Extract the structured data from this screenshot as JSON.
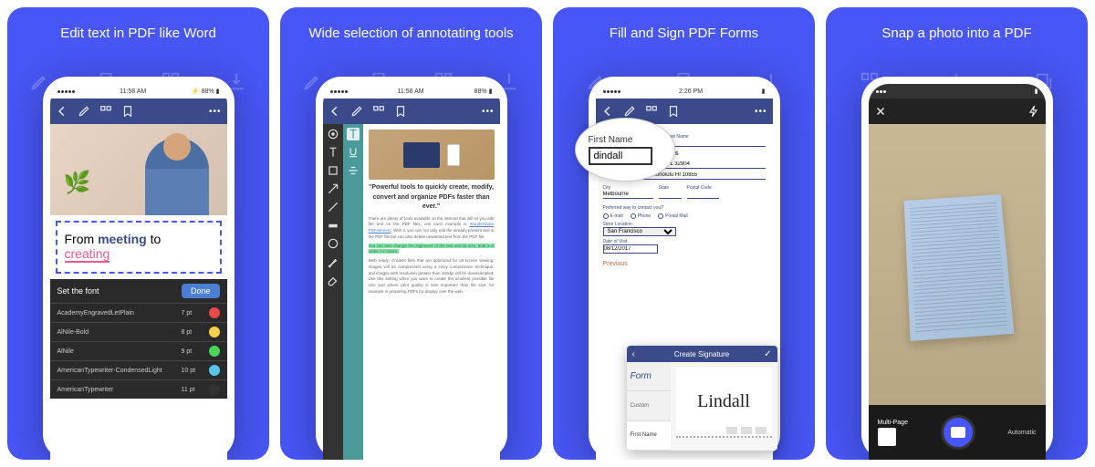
{
  "panels": [
    {
      "title": "Edit text in PDF like Word"
    },
    {
      "title": "Wide selection of annotating tools"
    },
    {
      "title": "Fill and Sign PDF Forms"
    },
    {
      "title": "Snap a photo into a PDF"
    }
  ],
  "status": {
    "time1": "11:58 AM",
    "time2": "2:26 PM",
    "carrier": "•••••",
    "battery": "88%"
  },
  "panel1": {
    "text1_prefix": "From ",
    "text1_highlight": "meeting",
    "text1_suffix": " to",
    "text2": "creating",
    "font_panel_title": "Set the font",
    "done": "Done",
    "fonts": [
      {
        "name": "AcademyEngravedLetPlain",
        "size": "7 pt",
        "color": "#e84a4a"
      },
      {
        "name": "AlNile-Bold",
        "size": "8 pt",
        "color": "#f5d04a"
      },
      {
        "name": "AlNile",
        "size": "9 pt",
        "color": "#4ad45a"
      },
      {
        "name": "AmericanTypewriter-CondensedLight",
        "size": "10 pt",
        "color": "#5ac4e8"
      },
      {
        "name": "AmericanTypewriter",
        "size": "11 pt",
        "color": "#333333"
      }
    ]
  },
  "panel2": {
    "heading": "\"Powerful tools to quickly create, modify, convert and organize PDFs faster than ever.\"",
    "para1_a": "There are plenty of tools available on the internet that will let you edit the text on the PDF files, one such example is ",
    "para1_link": "Wondershare PDFelement",
    "para1_b": ". With it, you can not only edit the already present text in the PDF file but can also delete unwanted text from the PDF file.",
    "para_hl": "You can also change the alignment of the text and its size, bold it or make it in italics.",
    "para2": "Web ready: Creates files that are optimized for on-screen viewing. Images will be compressed using a lossy compression technique, and images with resolution greater than 150dpi will be downsampled. Use this setting when you want to create the smallest possible file size and where print quality is less important than file size, for example in preparing PDFs for display over the web."
  },
  "panel3": {
    "zoom_label": "First Name",
    "zoom_value": "dindall",
    "section_address": "Address",
    "city_label": "City",
    "city_value": "Melbourne",
    "state_label": "State",
    "postal_label": "Postal Code",
    "contact_label": "Preferred way to contact you?",
    "opt_email": "E-mail",
    "opt_phone": "Phone",
    "opt_postal": "Postal Mail",
    "store_label": "Store Location",
    "store_value": "San Francisco",
    "date_label": "Date of Visit",
    "date_value": "08/12/2017",
    "signature_label": "Signature",
    "signature_value": "Lindall",
    "previous": "Previous",
    "last_name": "Last Name",
    "addr1": "Honolulu FL 32904",
    "addr2": "Apt. 999 Honolulu HI 10855",
    "sig_popup_title": "Create Signature",
    "sig_tab1": "Form",
    "sig_tab2": "Custom",
    "sig_tab3": "First Name",
    "form_side": "Form"
  },
  "panel4": {
    "mode_left": "Multi-Page",
    "mode_right": "Automatic"
  }
}
